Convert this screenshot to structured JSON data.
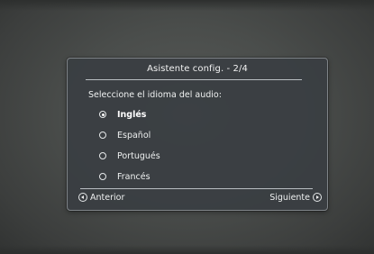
{
  "dialog": {
    "title": "Asistente config. - 2/4",
    "prompt": "Seleccione el idioma del audio:",
    "options": [
      {
        "label": "Inglés",
        "selected": true
      },
      {
        "label": "Español",
        "selected": false
      },
      {
        "label": "Portugués",
        "selected": false
      },
      {
        "label": "Francés",
        "selected": false
      }
    ],
    "prev_label": "Anterior",
    "next_label": "Siguiente"
  },
  "colors": {
    "background": "#4a4d4b",
    "panel": "#3a3e42",
    "text": "#eef0f0",
    "rule": "#b9bec2"
  },
  "icons": {
    "prev": "circled-left-arrow-icon",
    "next": "circled-right-arrow-icon",
    "option_unselected": "radio-empty-icon",
    "option_selected": "radio-filled-icon"
  }
}
